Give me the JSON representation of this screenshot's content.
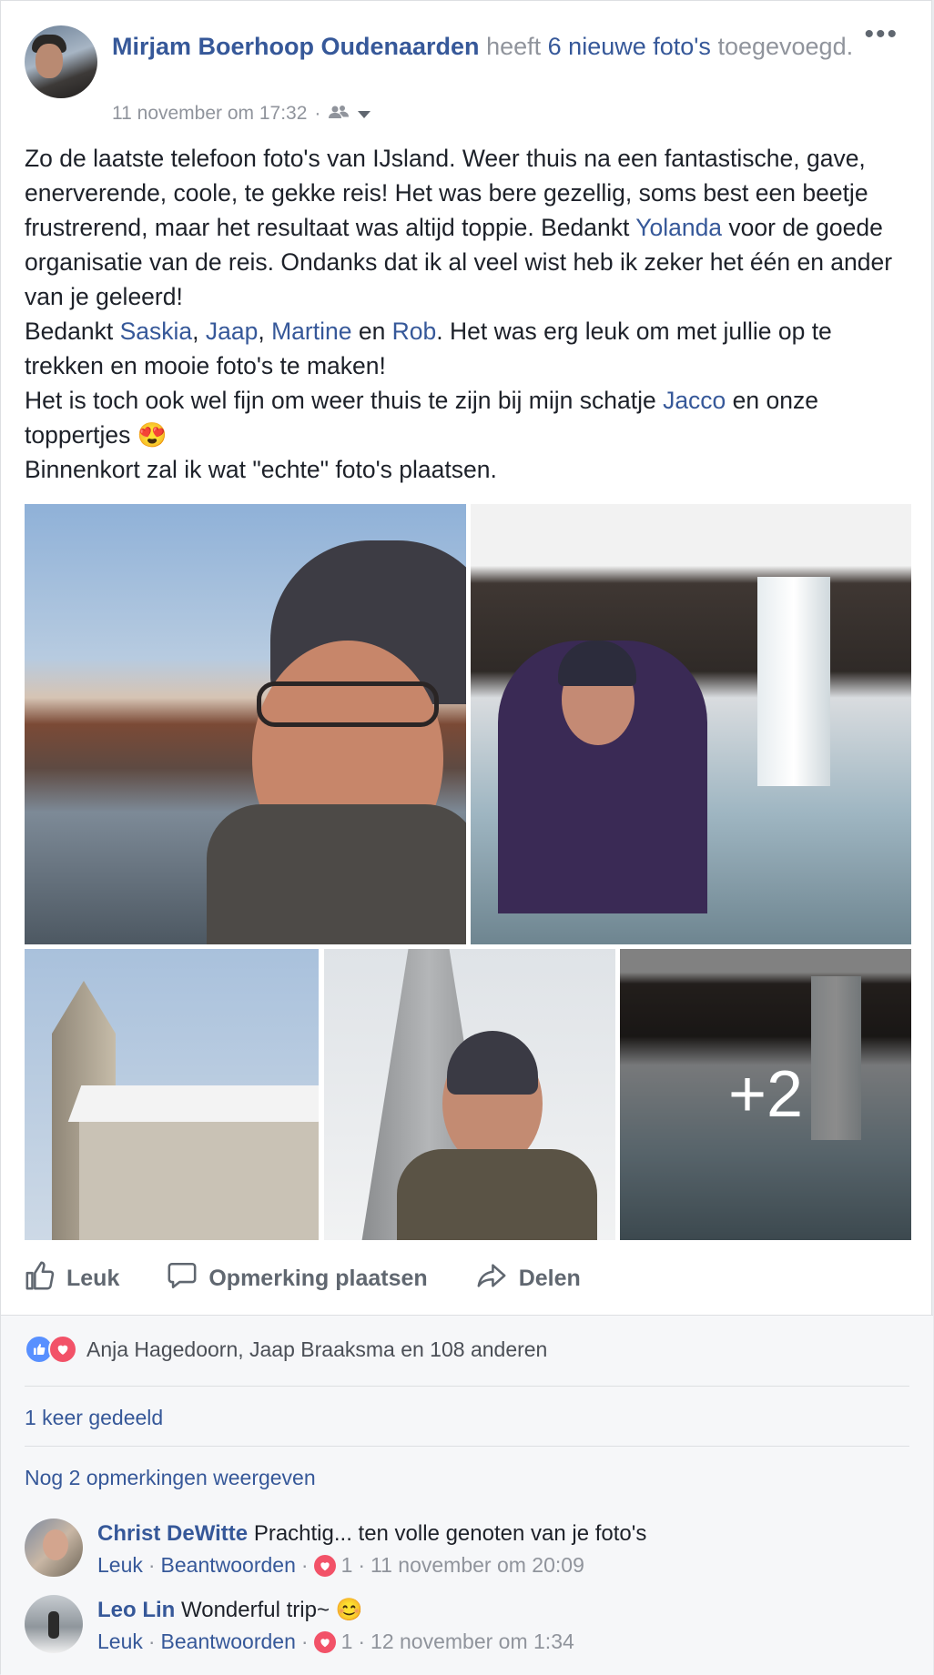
{
  "post": {
    "author": "Mirjam Boerhoop Oudenaarden",
    "action_prefix": "heeft",
    "action_link": "6 nieuwe foto's",
    "action_suffix": "toegevoegd.",
    "timestamp": "11 november om 17:32",
    "separator": "·",
    "more_label": "•••",
    "text": {
      "p1_a": "Zo de laatste telefoon foto's van IJsland. Weer thuis na een fantastische, gave, enerverende, coole, te gekke reis! Het was bere gezellig, soms best een beetje frustrerend, maar het resultaat was altijd toppie. Bedankt ",
      "p1_m": "Yolanda",
      "p1_b": " voor de goede organisatie van de reis. Ondanks dat ik al veel wist heb ik zeker het één en ander van je geleerd!",
      "p2_a": "Bedankt ",
      "p2_m1": "Saskia",
      "p2_s1": ", ",
      "p2_m2": "Jaap",
      "p2_s2": ", ",
      "p2_m3": "Martine",
      "p2_s3": " en ",
      "p2_m4": "Rob",
      "p2_b": ". Het was erg leuk om met jullie op te trekken en mooie foto's te maken!",
      "p3_a": "Het is toch ook wel fijn om weer thuis te zijn bij mijn schatje ",
      "p3_m": "Jacco",
      "p3_b": " en onze toppertjes 😍",
      "p4": "Binnenkort zal ik wat \"echte\" foto's plaatsen."
    },
    "photos_more": "+2"
  },
  "actions": {
    "like": "Leuk",
    "comment": "Opmerking plaatsen",
    "share": "Delen"
  },
  "reactions": {
    "summary": "Anja Hagedoorn, Jaap Braaksma en 108 anderen",
    "like_icon": "thumbs-up-icon",
    "love_icon": "heart-icon"
  },
  "shares": "1 keer gedeeld",
  "view_more_comments": "Nog 2 opmerkingen weergeven",
  "comments": [
    {
      "name": "Christ DeWitte",
      "text": "Prachtig... ten volle genoten van je foto's",
      "like": "Leuk",
      "reply": "Beantwoorden",
      "dot": "·",
      "reaction_count": "1",
      "time": "11 november om 20:09"
    },
    {
      "name": "Leo Lin",
      "text": "Wonderful trip~ 😊",
      "like": "Leuk",
      "reply": "Beantwoorden",
      "dot": "·",
      "reaction_count": "1",
      "time": "12 november om 1:34"
    }
  ],
  "colors": {
    "link": "#365899",
    "text": "#1d2129",
    "muted": "#90949c",
    "like_blue": "#5890ff",
    "love_red": "#f25268"
  }
}
